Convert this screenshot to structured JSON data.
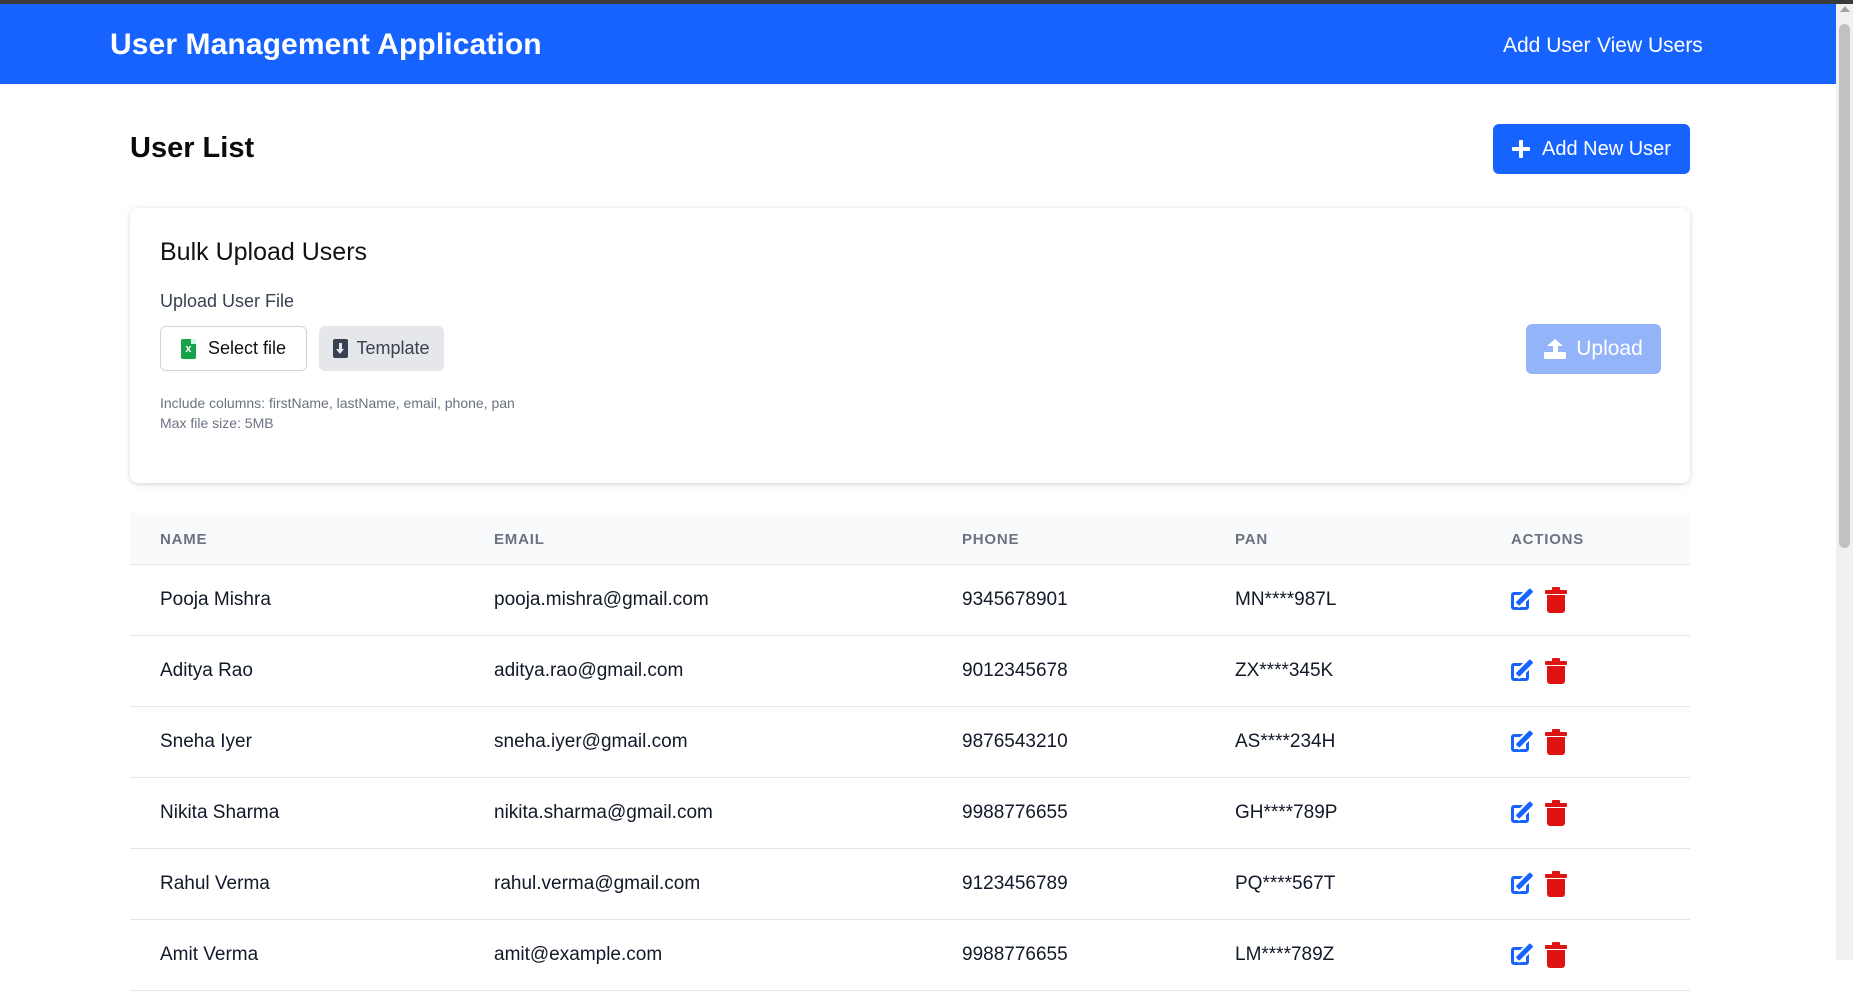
{
  "header": {
    "title": "User Management Application",
    "nav": [
      {
        "label": "Add User"
      },
      {
        "label": "View Users"
      }
    ]
  },
  "page": {
    "title": "User List",
    "add_new_label": "Add New User"
  },
  "bulk_upload": {
    "title": "Bulk Upload Users",
    "field_label": "Upload User File",
    "select_label": "Select file",
    "template_label": "Template",
    "hint_columns": "Include columns: firstName, lastName, email, phone, pan",
    "hint_size": "Max file size: 5MB",
    "upload_label": "Upload",
    "select_icon": "excel-file-icon",
    "template_icon": "file-download-icon",
    "upload_icon": "upload-icon"
  },
  "table": {
    "headers": [
      "NAME",
      "EMAIL",
      "PHONE",
      "PAN",
      "ACTIONS"
    ],
    "rows": [
      {
        "name": "Pooja Mishra",
        "email": "pooja.mishra@gmail.com",
        "phone": "9345678901",
        "pan": "MN****987L"
      },
      {
        "name": "Aditya Rao",
        "email": "aditya.rao@gmail.com",
        "phone": "9012345678",
        "pan": "ZX****345K"
      },
      {
        "name": "Sneha Iyer",
        "email": "sneha.iyer@gmail.com",
        "phone": "9876543210",
        "pan": "AS****234H"
      },
      {
        "name": "Nikita Sharma",
        "email": "nikita.sharma@gmail.com",
        "phone": "9988776655",
        "pan": "GH****789P"
      },
      {
        "name": "Rahul Verma",
        "email": "rahul.verma@gmail.com",
        "phone": "9123456789",
        "pan": "PQ****567T"
      },
      {
        "name": "Amit Verma",
        "email": "amit@example.com",
        "phone": "9988776655",
        "pan": "LM****789Z"
      }
    ]
  },
  "colors": {
    "primary": "#1663ff",
    "primary_disabled": "#93b4f9",
    "danger": "#e01313",
    "excel_green": "#16a34a"
  }
}
